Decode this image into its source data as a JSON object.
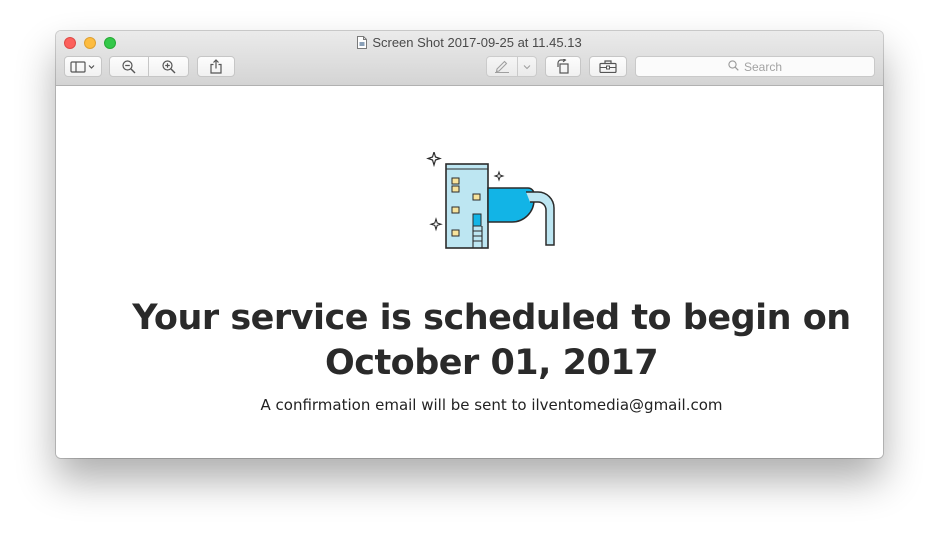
{
  "window": {
    "title": "Screen Shot 2017-09-25 at 11.45.13"
  },
  "toolbar": {
    "sidebar_button": "sidebar-toggle",
    "zoom_out": "zoom-out",
    "zoom_in": "zoom-in",
    "share": "share",
    "markup": "markup",
    "rotate": "rotate",
    "toolbox": "toolbox"
  },
  "search": {
    "placeholder": "Search"
  },
  "page": {
    "headline": "Your service is scheduled to begin on October 01, 2017",
    "subtext": "A confirmation email will be sent to ilventomedia@gmail.com"
  },
  "colors": {
    "accent_blue": "#12b4e6",
    "building_light": "#bde6f2",
    "window_yellow": "#f7e39c",
    "outline": "#2b2b2b"
  }
}
